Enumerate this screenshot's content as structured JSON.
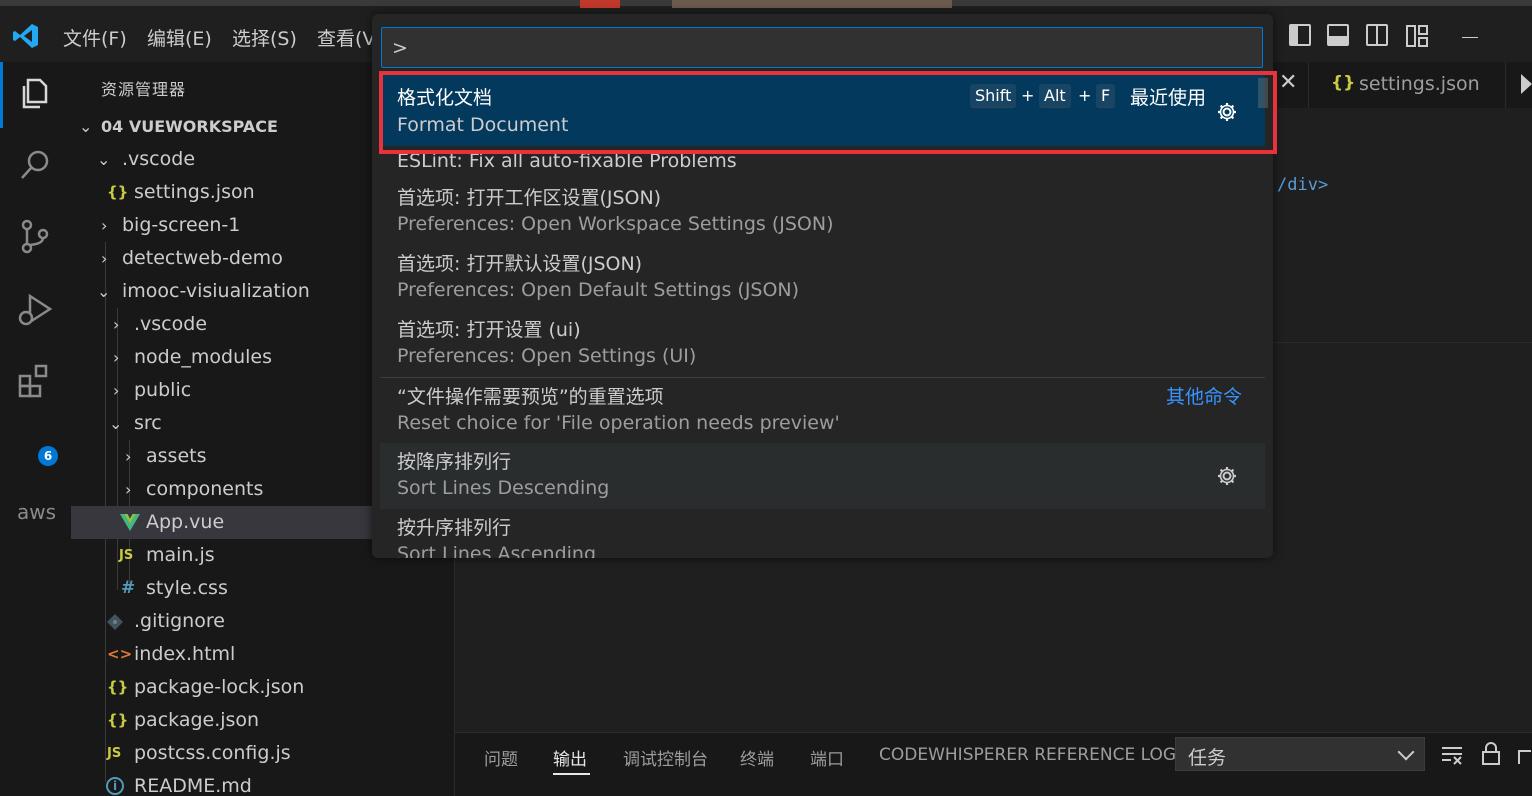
{
  "titlebar": {
    "menus": [
      "文件(F)",
      "编辑(E)",
      "选择(S)",
      "查看(V"
    ]
  },
  "activitybar": {
    "extensions_badge": "6",
    "aws_label": "aws"
  },
  "sidebar": {
    "title": "资源管理器",
    "root": "04 VUEWORKSPACE",
    "items": [
      {
        "label": ".vscode"
      },
      {
        "label": "settings.json"
      },
      {
        "label": "big-screen-1"
      },
      {
        "label": "detectweb-demo"
      },
      {
        "label": "imooc-visiualization"
      },
      {
        "label": ".vscode"
      },
      {
        "label": "node_modules"
      },
      {
        "label": "public"
      },
      {
        "label": "src"
      },
      {
        "label": "assets"
      },
      {
        "label": "components"
      },
      {
        "label": "App.vue"
      },
      {
        "label": "main.js"
      },
      {
        "label": "style.css"
      },
      {
        "label": ".gitignore"
      },
      {
        "label": "index.html"
      },
      {
        "label": "package-lock.json"
      },
      {
        "label": "package.json"
      },
      {
        "label": "postcss.config.js"
      },
      {
        "label": "README.md"
      }
    ],
    "icon_glyphs": {
      "braces": "{}",
      "js": "JS",
      "hash": "#",
      "html": "<>",
      "info": "i"
    }
  },
  "editor": {
    "tab_label": "settings.json",
    "code_fragment": "/div>"
  },
  "palette": {
    "input_value": ">",
    "items": [
      {
        "label": "格式化文档",
        "detail": "Format Document",
        "keys": [
          "Shift",
          "Alt",
          "F"
        ],
        "plus": "+",
        "tag": "最近使用"
      },
      {
        "label": "ESLint: Fix all auto-fixable Problems"
      },
      {
        "label": "首选项: 打开工作区设置(JSON)",
        "detail": "Preferences: Open Workspace Settings (JSON)"
      },
      {
        "label": "首选项: 打开默认设置(JSON)",
        "detail": "Preferences: Open Default Settings (JSON)"
      },
      {
        "label": "首选项: 打开设置 (ui)",
        "detail": "Preferences: Open Settings (UI)"
      },
      {
        "label": "“文件操作需要预览”的重置选项",
        "detail": "Reset choice for 'File operation needs preview'",
        "tag": "其他命令"
      },
      {
        "label": "按降序排列行",
        "detail": "Sort Lines Descending"
      },
      {
        "label": "按升序排列行",
        "detail": "Sort Lines Ascending"
      }
    ]
  },
  "panel": {
    "tabs": [
      "问题",
      "输出",
      "调试控制台",
      "终端",
      "端口",
      "CODEWHISPERER REFERENCE LOG"
    ],
    "active_tab": "输出",
    "task_select": "任务"
  },
  "colors": {
    "accent": "#0078d4",
    "focus_row": "#04395e",
    "highlight_box": "#e8323c",
    "link": "#3794ff"
  }
}
